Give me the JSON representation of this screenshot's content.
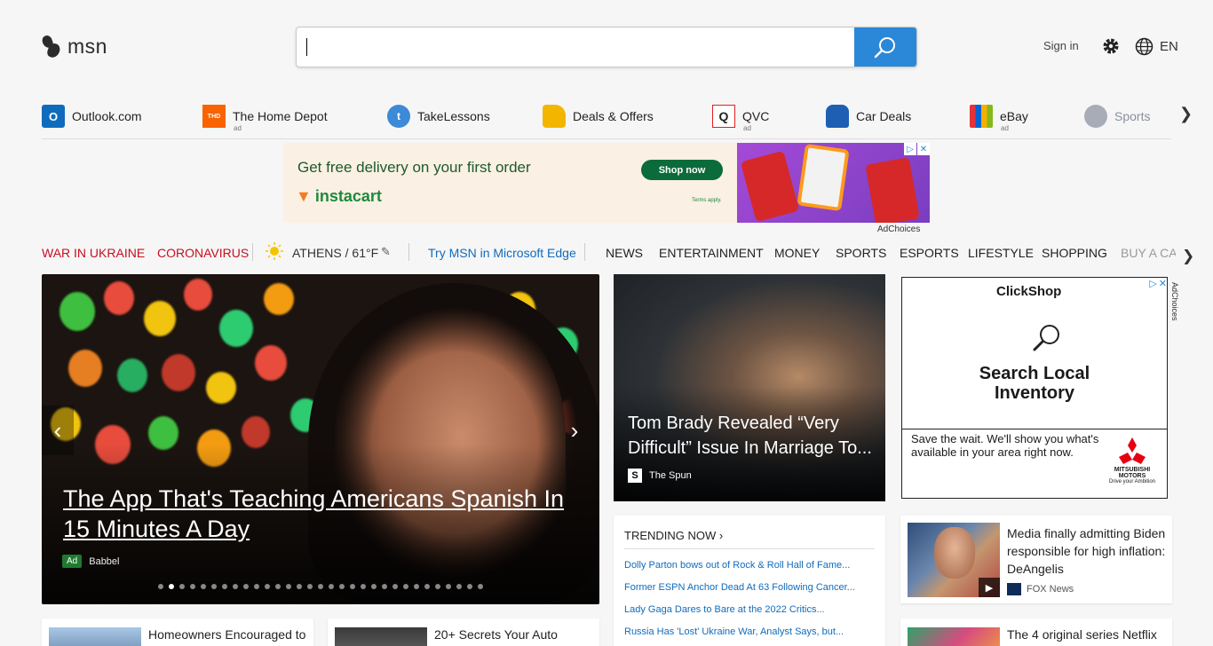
{
  "header": {
    "logo_text": "msn",
    "search_value": "",
    "sign_in": "Sign in",
    "language": "EN"
  },
  "quick_links": [
    {
      "label": "Outlook.com",
      "ad": "",
      "icon": "outlook-icon",
      "color": "#0f6cbd"
    },
    {
      "label": "The Home Depot",
      "ad": "ad",
      "icon": "home-depot-icon",
      "color": "#f96302"
    },
    {
      "label": "TakeLessons",
      "ad": "",
      "icon": "takelessons-icon",
      "color": "#3c8ad8"
    },
    {
      "label": "Deals & Offers",
      "ad": "",
      "icon": "tag-icon",
      "color": "#f2b600"
    },
    {
      "label": "QVC",
      "ad": "ad",
      "icon": "qvc-icon",
      "color": "#e02020"
    },
    {
      "label": "Car Deals",
      "ad": "",
      "icon": "car-icon",
      "color": "#1e5fb4"
    },
    {
      "label": "eBay",
      "ad": "ad",
      "icon": "shopping-bag-icon",
      "color": "#000000"
    },
    {
      "label": "Sports",
      "ad": "",
      "icon": "sports-icon",
      "color": "#8a8f9c"
    }
  ],
  "banner_ad": {
    "headline": "Get free delivery on your first order",
    "brand": "instacart",
    "cta": "Shop now",
    "terms": "Terms apply.",
    "ad_choices": "AdChoices"
  },
  "nav": {
    "alerts": [
      "WAR IN UKRAINE",
      "CORONAVIRUS"
    ],
    "weather": "ATHENS / 61°F",
    "edge_promo": "Try MSN in Microsoft Edge",
    "categories": [
      "NEWS",
      "ENTERTAINMENT",
      "MONEY",
      "SPORTS",
      "ESPORTS",
      "LIFESTYLE",
      "SHOPPING",
      "BUY A CA"
    ]
  },
  "hero": {
    "title": "The App That's Teaching Americans Spanish In 15 Minutes A Day",
    "ad_badge": "Ad",
    "source": "Babbel",
    "slide_count": 31,
    "active_slide": 2
  },
  "card_brady": {
    "title": "Tom Brady Revealed “Very Difficult” Issue In Marriage To...",
    "source_logo": "S",
    "source": "The Spun"
  },
  "right_ad": {
    "brand": "ClickShop",
    "headline_1": "Search Local",
    "headline_2": "Inventory",
    "body": "Save the wait. We'll show you what's available in your area right now.",
    "sponsor": "MITSUBISHI MOTORS",
    "tagline": "Drive your Ambition",
    "ad_choices": "AdChoices"
  },
  "trending": {
    "heading": "TRENDING NOW",
    "items": [
      "Dolly Parton bows out of Rock & Roll Hall of Fame...",
      "Former ESPN Anchor Dead At 63 Following Cancer...",
      "Lady Gaga Dares to Bare at the 2022 Critics...",
      "Russia Has 'Lost' Ukraine War, Analyst Says, but..."
    ]
  },
  "card_psaki": {
    "title": "Media finally admitting Biden responsible for high inflation: DeAngelis",
    "source": "FOX News"
  },
  "bottom_cards": [
    {
      "title": "Homeowners Encouraged to"
    },
    {
      "title": "20+ Secrets Your Auto"
    },
    {
      "title": "The 4 original series Netflix"
    }
  ]
}
